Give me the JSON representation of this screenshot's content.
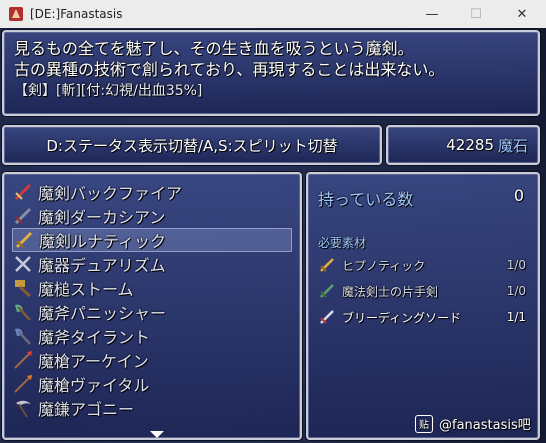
{
  "window": {
    "title": "[DE:]Fanastasis",
    "minimize_glyph": "—",
    "maximize_glyph": "☐",
    "close_glyph": "✕"
  },
  "description": {
    "line1": "見るもの全てを魅了し、その生き血を吸うという魔剣。",
    "line2": "古の異種の技術で創られており、再現することは出来ない。",
    "tags": "【剣】[斬][付:幻視/出血35%]"
  },
  "help": {
    "text": "D:ステータス表示切替/A,S:スピリット切替"
  },
  "gold": {
    "amount": "42285",
    "unit": "魔石"
  },
  "items": [
    {
      "name": "魔剣バックファイア",
      "icon": "sword-red-icon"
    },
    {
      "name": "魔剣ダーカシアン",
      "icon": "sword-dark-icon"
    },
    {
      "name": "魔剣ルナティック",
      "icon": "sword-gold-icon"
    },
    {
      "name": "魔器デュアリズム",
      "icon": "crossed-blades-icon"
    },
    {
      "name": "魔槌ストーム",
      "icon": "hammer-icon"
    },
    {
      "name": "魔斧パニッシャー",
      "icon": "axe-green-icon"
    },
    {
      "name": "魔斧タイラント",
      "icon": "axe-blue-icon"
    },
    {
      "name": "魔槍アーケイン",
      "icon": "spear-red-icon"
    },
    {
      "name": "魔槍ヴァイタル",
      "icon": "spear-orange-icon"
    },
    {
      "name": "魔鎌アゴニー",
      "icon": "scythe-icon"
    }
  ],
  "selected_index": 2,
  "info": {
    "owned_label": "持っている数",
    "owned_count": "0",
    "required_label": "必要素材",
    "materials": [
      {
        "name": "ヒプノティック",
        "count": "1/0",
        "icon": "sword-gold-icon"
      },
      {
        "name": "魔法剣士の片手剣",
        "count": "1/0",
        "icon": "sword-green-icon"
      },
      {
        "name": "ブリーディングソード",
        "count": "1/1",
        "icon": "sword-blood-icon"
      }
    ]
  },
  "watermark": {
    "text": "@fanastasis吧",
    "badge": "贴"
  },
  "colors": {
    "accent_blue": "#9fc9ff",
    "panel_top": "#3a4884",
    "panel_bottom": "#1e2656"
  }
}
